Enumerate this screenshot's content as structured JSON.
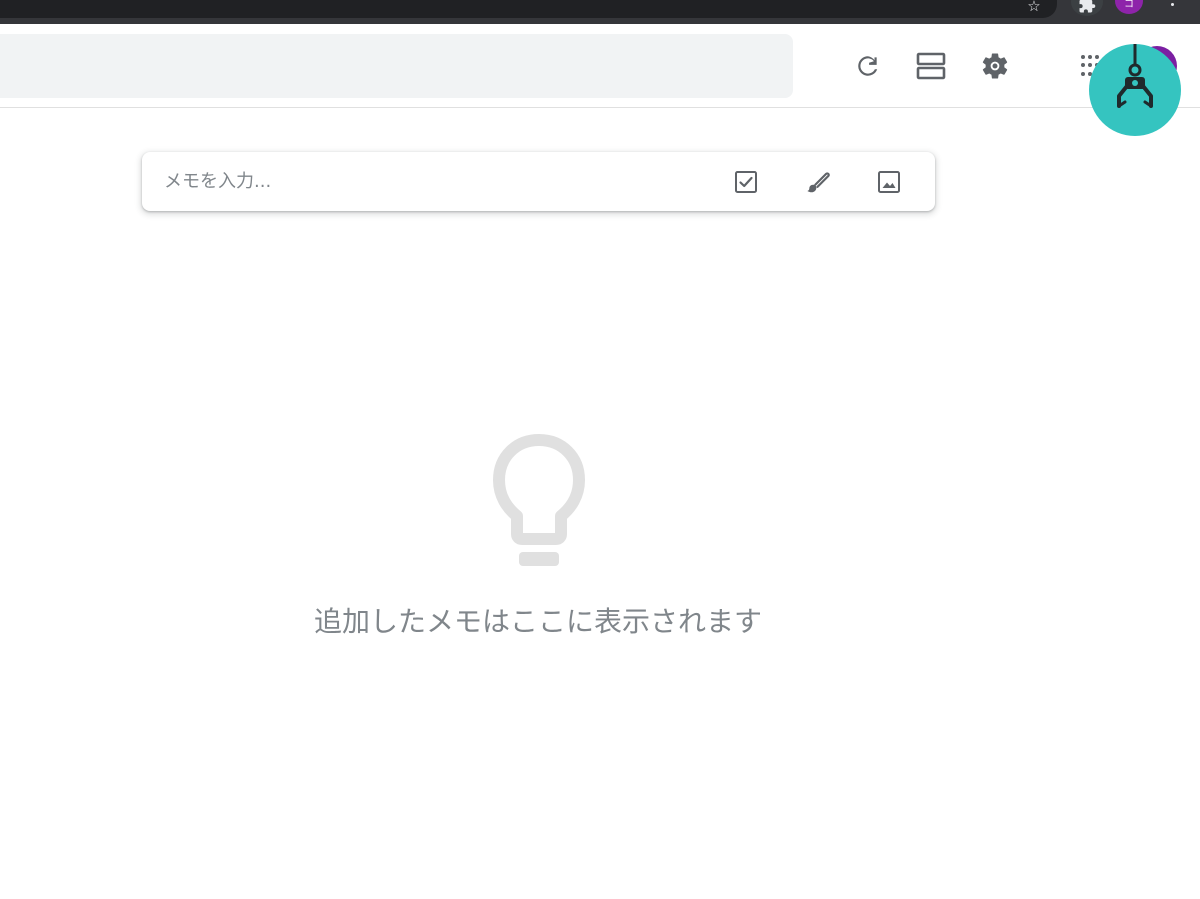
{
  "browser": {
    "profile_initial": "コ",
    "bookmark_star": "☆"
  },
  "header": {
    "search_placeholder": "",
    "refresh_label": "refresh-icon",
    "layout_label": "list-view-icon",
    "settings_label": "settings-icon"
  },
  "note_input": {
    "placeholder": "メモを入力..."
  },
  "empty_state": {
    "message": "追加したメモはここに表示されます"
  },
  "colors": {
    "fab": "#35c4c0",
    "avatar": "#7b1fa2",
    "icon": "#5f6368",
    "empty_icon": "#e0e0e0"
  }
}
